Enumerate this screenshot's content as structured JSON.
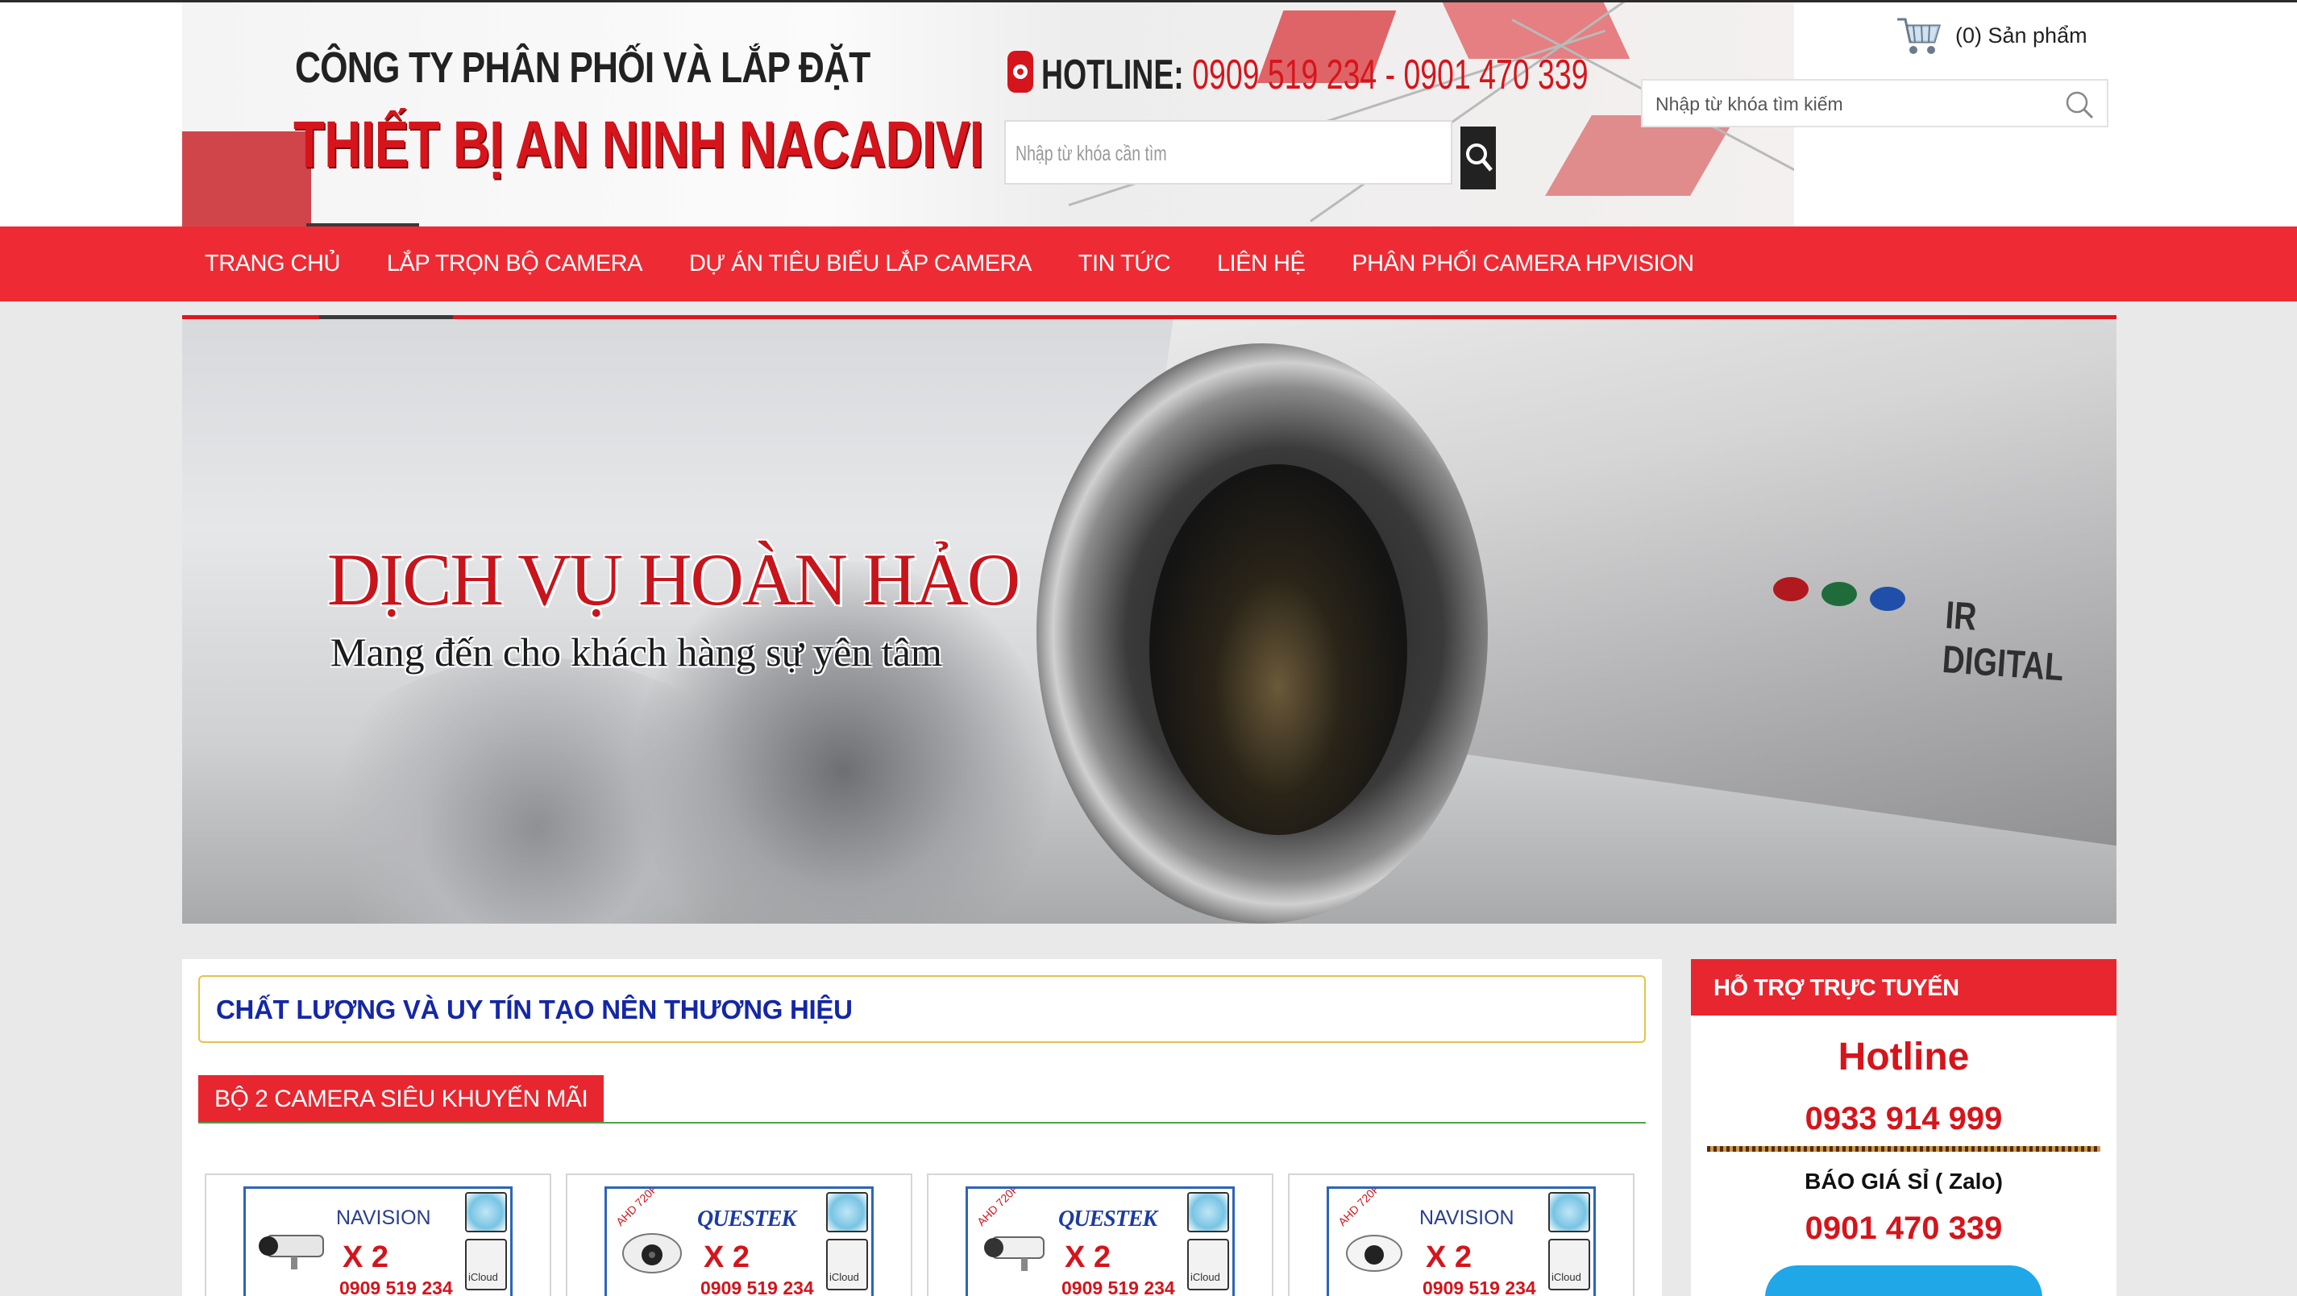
{
  "header": {
    "company_line1": "CÔNG TY PHÂN PHỐI VÀ LẮP ĐẶT",
    "company_line2": "THIẾT BỊ AN NINH NACADIVI",
    "hotline_label": "HOTLINE:",
    "hotline_numbers": "0909 519 234 - 0901 470 339",
    "banner_search_placeholder": "Nhập từ khóa cần tìm"
  },
  "cart": {
    "text": "(0) Sản phẩm"
  },
  "search": {
    "placeholder": "Nhập từ khóa tìm kiếm"
  },
  "nav": {
    "items": [
      {
        "label": "TRANG CHỦ"
      },
      {
        "label": "LẮP TRỌN BỘ CAMERA"
      },
      {
        "label": "DỰ ÁN TIÊU BIỂU LẮP CAMERA"
      },
      {
        "label": "TIN TỨC"
      },
      {
        "label": "LIÊN HỆ"
      },
      {
        "label": "PHÂN PHỐI CAMERA HPVISION"
      }
    ]
  },
  "slider": {
    "title": "DỊCH VỤ HOÀN HẢO",
    "subtitle": "Mang đến cho khách hàng sự yên tâm",
    "camera_label": "IR DIGITAL"
  },
  "main": {
    "slogan": "CHẤT LƯỢNG VÀ UY TÍN TẠO NÊN THƯƠNG HIỆU",
    "section_title": "BỘ 2 CAMERA SIÊU KHUYẾN MÃI",
    "products": [
      {
        "brand": "NAVISION",
        "qty": "X 2",
        "phone": "0909 519 234",
        "ahd": "",
        "cloud": "iCloud"
      },
      {
        "brand": "QUESTEK",
        "qty": "X 2",
        "phone": "0909 519 234",
        "ahd": "AHD 720P",
        "cloud": "iCloud"
      },
      {
        "brand": "QUESTEK",
        "qty": "X 2",
        "phone": "0909 519 234",
        "ahd": "AHD 720P",
        "cloud": "iCloud"
      },
      {
        "brand": "NAVISION",
        "qty": "X 2",
        "phone": "0909 519 234",
        "ahd": "AHD 720P",
        "cloud": "iCloud"
      }
    ]
  },
  "sidebar": {
    "title": "HỖ TRỢ TRỰC TUYẾN",
    "hotline_label": "Hotline",
    "hotline_number": "0933 914 999",
    "zalo_label": "BÁO GIÁ SỈ ( Zalo)",
    "zalo_number": "0901 470 339"
  },
  "colors": {
    "accent_red": "#ee2b34",
    "slogan_blue": "#1427a6",
    "hotline_red": "#d5141b"
  }
}
